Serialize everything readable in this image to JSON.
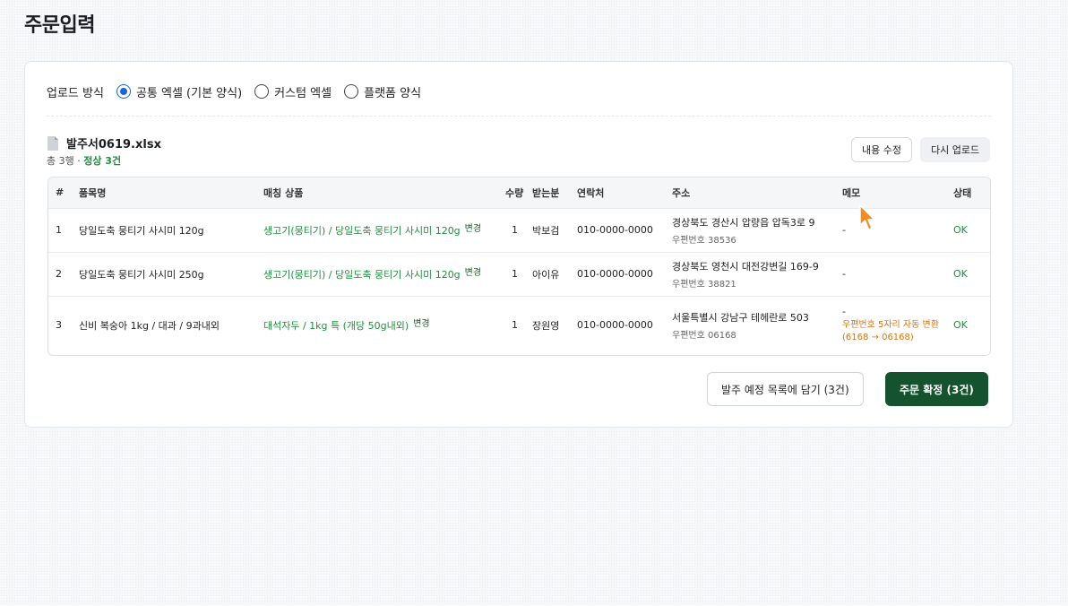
{
  "page": {
    "title": "주문입력"
  },
  "upload": {
    "label": "업로드 방식",
    "options": [
      {
        "label": "공통 엑셀 (기본 양식)",
        "selected": true
      },
      {
        "label": "커스텀 엑셀",
        "selected": false
      },
      {
        "label": "플랫폼 양식",
        "selected": false
      }
    ]
  },
  "file": {
    "name": "발주서0619.xlsx",
    "summary_prefix": "총 3행 · ",
    "summary_ok": "정상 3건",
    "icon": "document-icon"
  },
  "actions": {
    "edit_label": "내용 수정",
    "reupload_label": "다시 업로드",
    "hold_label": "발주 예정 목록에 담기 (3건)",
    "confirm_label": "주문 확정 (3건)"
  },
  "table": {
    "headers": [
      "#",
      "품목명",
      "매칭 상품",
      "수량",
      "받는분",
      "연락처",
      "주소",
      "메모",
      "상태"
    ],
    "change_label": "변경",
    "rows": [
      {
        "no": "1",
        "item": "당일도축 뭉티기 사시미 120g",
        "match": "생고기(뭉티기) / 당일도축 뭉티기 사시미 120g",
        "qty": "1",
        "receiver": "박보검",
        "phone": "010-0000-0000",
        "address": "경상북도 경산시 압량읍 압독3로 9",
        "zip": "우편번호 38536",
        "memo": "-",
        "memo_note": "",
        "status": "OK"
      },
      {
        "no": "2",
        "item": "당일도축 뭉티기 사시미 250g",
        "match": "생고기(뭉티기) / 당일도축 뭉티기 사시미 120g",
        "qty": "1",
        "receiver": "아이유",
        "phone": "010-0000-0000",
        "address": "경상북도 영천시 대전강변길 169-9",
        "zip": "우편번호 38821",
        "memo": "-",
        "memo_note": "",
        "status": "OK"
      },
      {
        "no": "3",
        "item": "신비 복숭아 1kg / 대과 / 9과내외",
        "match": "대석자두 / 1kg 특 (개당 50g내외)",
        "qty": "1",
        "receiver": "장원영",
        "phone": "010-0000-0000",
        "address": "서울특별시 강남구 테헤란로 503",
        "zip": "우편번호 06168",
        "memo": "-",
        "memo_note": "우편번호 5자리 자동 변환 (6168 → 06168)",
        "status": "OK"
      }
    ]
  },
  "colors": {
    "accent_green": "#14532d",
    "ok_green": "#1e8e3e",
    "warning_orange": "#d9740f",
    "radio_blue": "#1a66d6",
    "cursor_orange": "#f28c1e"
  }
}
